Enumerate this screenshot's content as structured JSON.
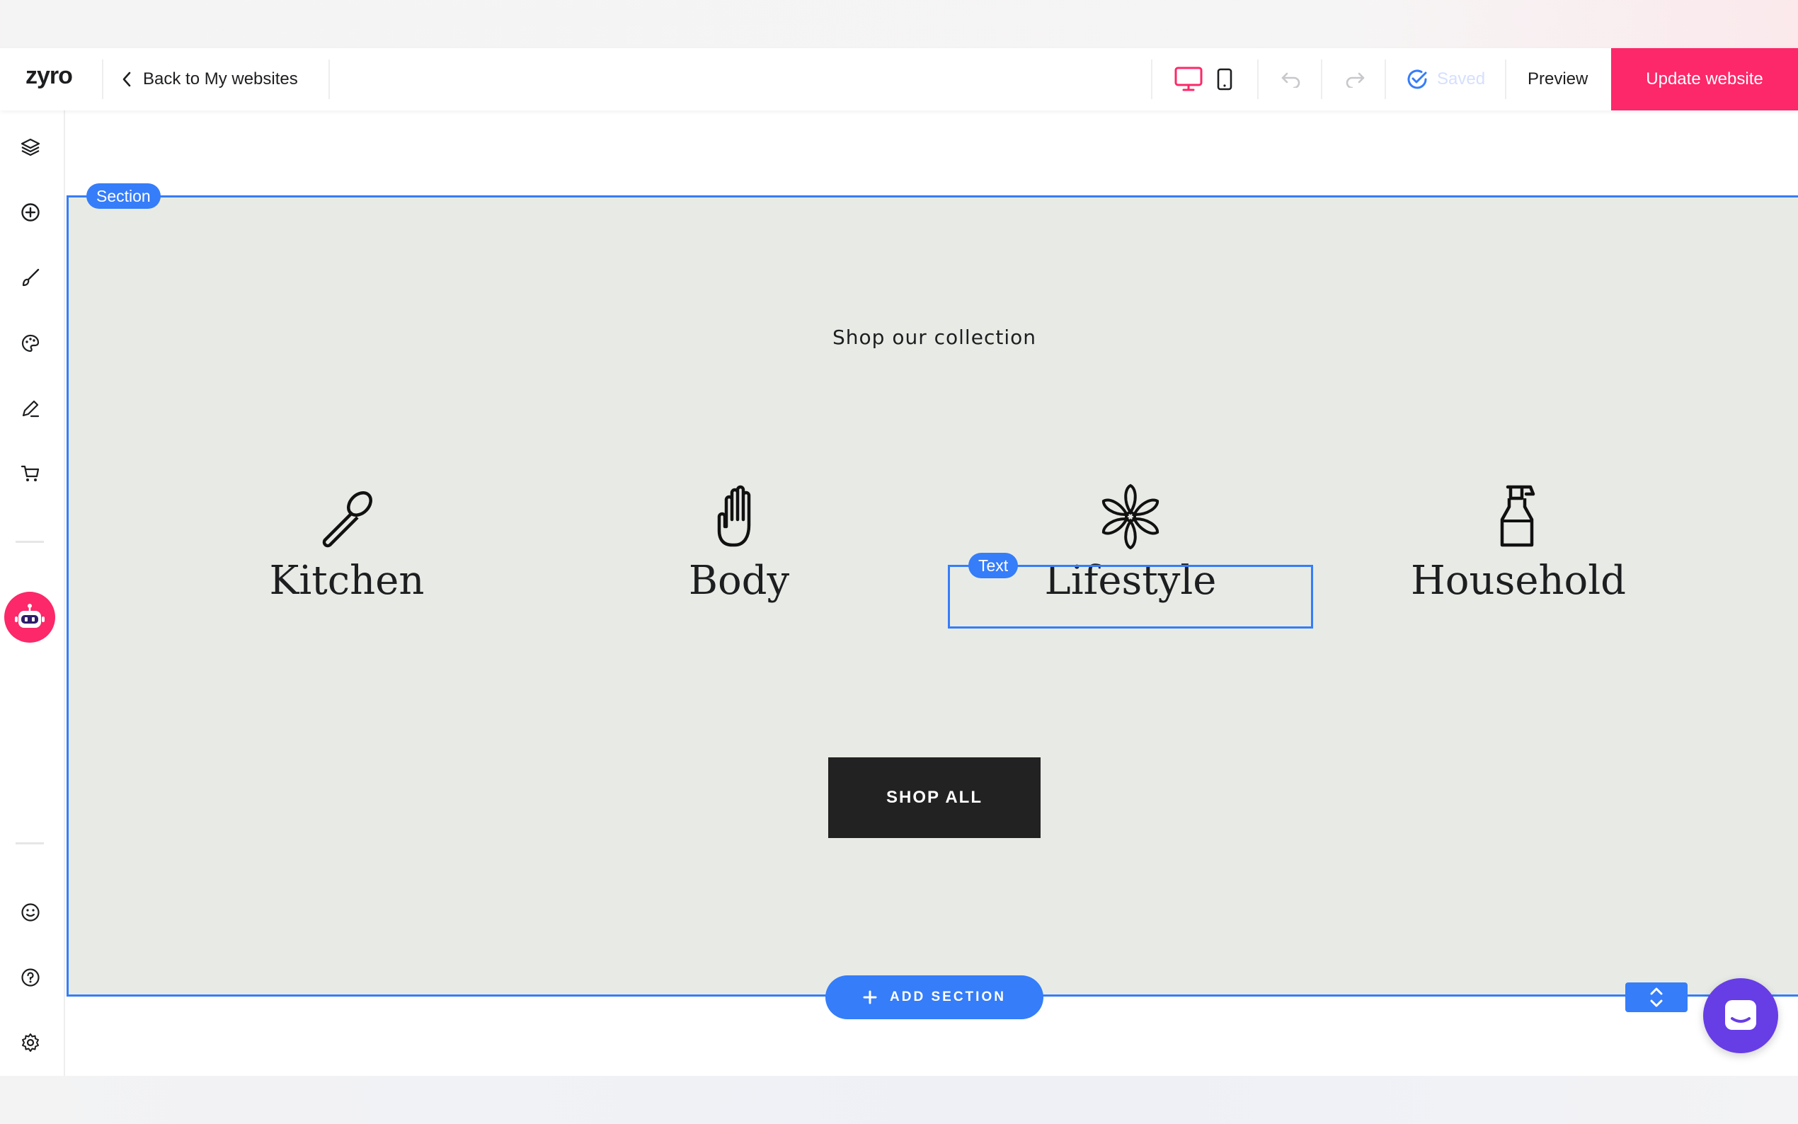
{
  "header": {
    "logo": "zyro",
    "back_label": "Back to My websites",
    "saved_label": "Saved",
    "preview_label": "Preview",
    "update_label": "Update website"
  },
  "editor": {
    "section_tag": "Section",
    "text_tag": "Text",
    "add_section_label": "ADD SECTION"
  },
  "content": {
    "heading": "Shop our collection",
    "categories": [
      {
        "label": "Kitchen",
        "icon": "spoon-icon"
      },
      {
        "label": "Body",
        "icon": "hand-icon"
      },
      {
        "label": "Lifestyle",
        "icon": "flower-icon"
      },
      {
        "label": "Household",
        "icon": "spray-bottle-icon"
      }
    ],
    "shop_all_label": "SHOP ALL"
  },
  "colors": {
    "accent_blue": "#357df9",
    "brand_pink": "#fc2869",
    "section_bg": "#e8ebe5",
    "chat_purple": "#673de6"
  }
}
